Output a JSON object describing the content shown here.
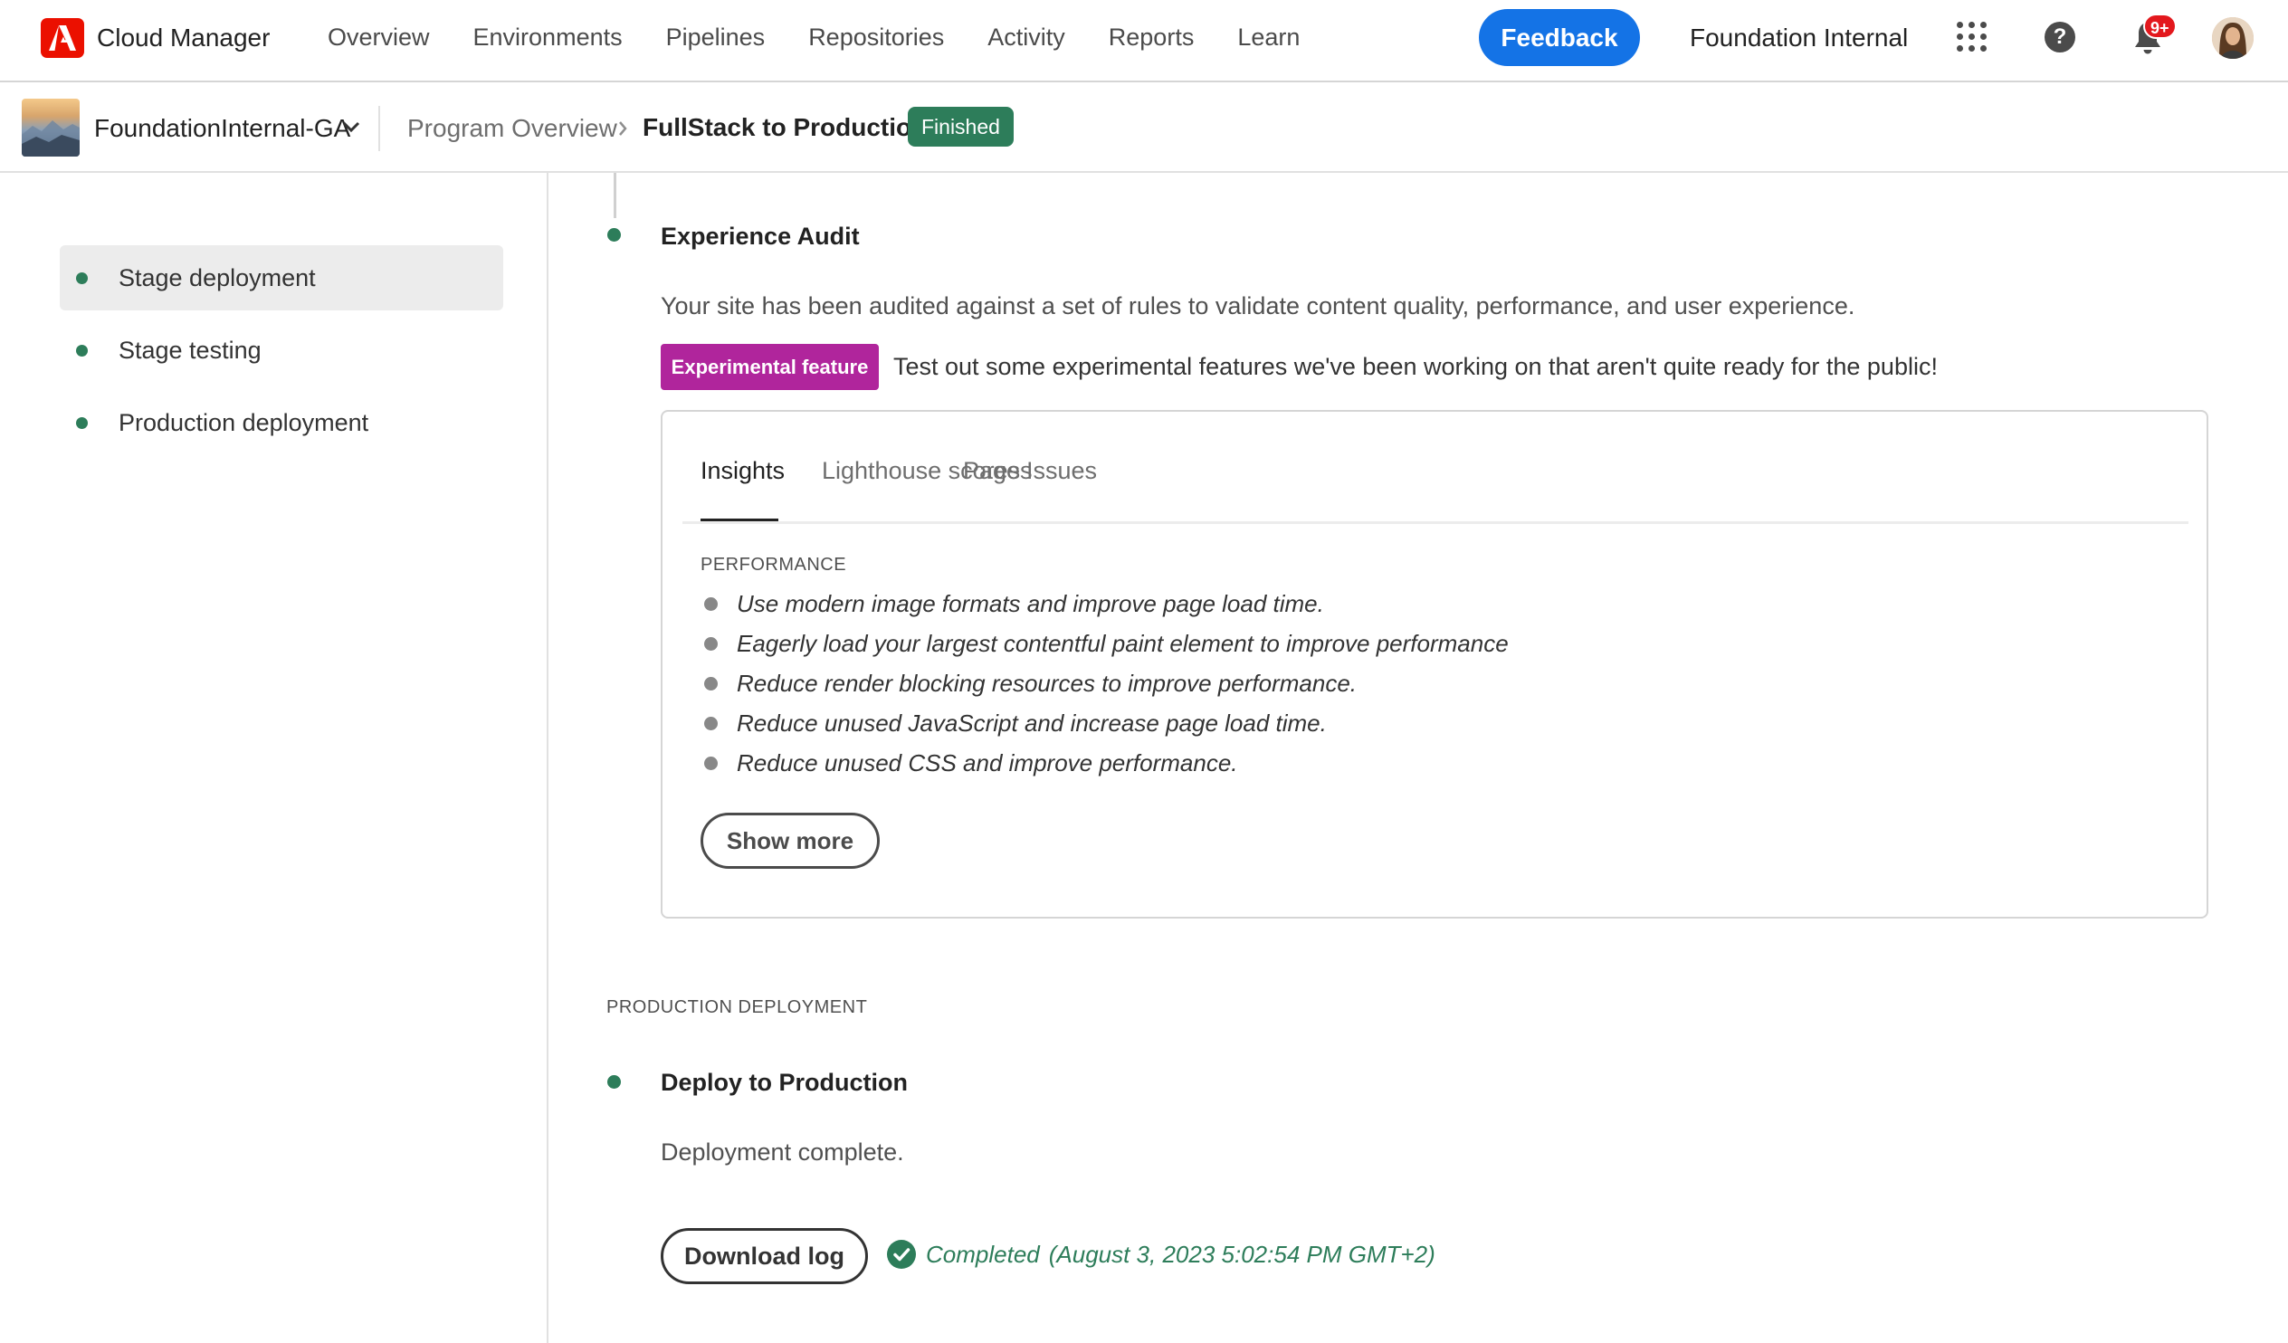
{
  "app": {
    "name": "Cloud Manager",
    "nav": [
      "Overview",
      "Environments",
      "Pipelines",
      "Repositories",
      "Activity",
      "Reports",
      "Learn"
    ],
    "feedback_label": "Feedback",
    "org_name": "Foundation Internal",
    "notification_count": "9+"
  },
  "subheader": {
    "program_name": "FoundationInternal-GA",
    "breadcrumb_root": "Program Overview",
    "breadcrumb_current": "FullStack to Production",
    "status": "Finished",
    "status_color": "#2d7d5a"
  },
  "sidebar": {
    "items": [
      {
        "label": "Stage deployment"
      },
      {
        "label": "Stage testing"
      },
      {
        "label": "Production deployment"
      }
    ]
  },
  "audit": {
    "title": "Experience Audit",
    "description": "Your site has been audited against a set of rules to validate content quality, performance, and user experience.",
    "badge": "Experimental feature",
    "badge_color": "#b0259c",
    "badge_text": "Test out some experimental features we've been working on that aren't quite ready for the public!",
    "tabs": [
      "Insights",
      "Lighthouse scores",
      "Pages",
      "Issues"
    ],
    "active_tab": "Insights",
    "section": "PERFORMANCE",
    "insights": [
      "Use modern image formats and improve page load time.",
      "Eagerly load your largest contentful paint element to improve performance",
      "Reduce render blocking resources to improve performance.",
      "Reduce unused JavaScript and increase page load time.",
      "Reduce unused CSS and improve performance."
    ],
    "show_more_label": "Show more"
  },
  "production": {
    "section_label": "PRODUCTION DEPLOYMENT",
    "title": "Deploy to Production",
    "description": "Deployment complete.",
    "download_label": "Download log",
    "completed_label": "Completed",
    "completed_time": "(August 3, 2023 5:02:54 PM GMT+2)"
  }
}
